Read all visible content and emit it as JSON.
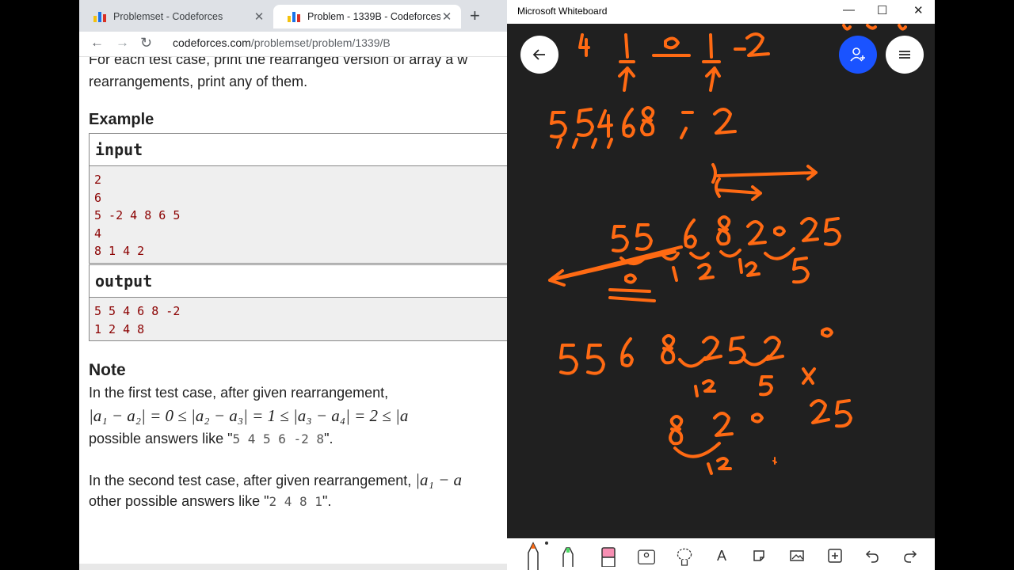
{
  "browser": {
    "tabs": [
      {
        "title": "Problemset - Codeforces",
        "close": "✕"
      },
      {
        "title": "Problem - 1339B - Codeforces",
        "close": "✕"
      }
    ],
    "new_tab": "+",
    "nav": {
      "back": "←",
      "forward": "→",
      "reload": "↻"
    },
    "url_host": "codeforces.com",
    "url_path": "/problemset/problem/1339/B"
  },
  "problem": {
    "partial_top": "For each test case, print the rearranged version of array a w",
    "rearr_line": "rearrangements, print any of them.",
    "example_heading": "Example",
    "input_label": "input",
    "input_lines": [
      "2",
      "6",
      "5 -2 4 8 6 5",
      "4",
      "8 1 4 2"
    ],
    "output_label": "output",
    "output_lines": [
      "5 5 4 6 8 -2",
      "1 2 4 8"
    ],
    "note_heading": "Note",
    "note1_text": "In the first test case, after given rearrangement,",
    "note1_math": "|a₁ − a₂| = 0 ≤ |a₂ − a₃| = 1 ≤ |a₃ − a₄| = 2 ≤ |a",
    "note1_tail_pre": "possible answers like \"",
    "note1_tail_code": "5 4 5 6 -2 8",
    "note1_tail_post": "\".",
    "note2_text": "In the second test case, after given rearrangement,",
    "note2_math": "|a₁ − a",
    "note2_tail_pre": "other possible answers like \"",
    "note2_tail_code": "2 4 8 1",
    "note2_tail_post": "\"."
  },
  "whiteboard": {
    "title": "Microsoft Whiteboard",
    "controls": {
      "minimize": "—",
      "maximize": "☐",
      "close": "✕"
    },
    "ink_color": "#ff6a13",
    "ink_text": {
      "top_row": "4 1 0 1 2",
      "seq": "5,5,4,6,8 ,-2",
      "mid_row": "5 5 6 8 2 0 25",
      "mid_diffs": "0 1 2 12 5",
      "low_row": "5 5 6 8 2 5 2 0",
      "low_diffs": "12 5 4",
      "bottom_row": "8 2 0 2 5",
      "bottom_diff": "12"
    },
    "tools": [
      "pen",
      "highlighter",
      "eraser",
      "lasso",
      "ruler",
      "text",
      "note",
      "image",
      "add",
      "undo",
      "redo"
    ],
    "text_tool": "A"
  },
  "colors": {
    "wb_bg": "#202020",
    "accent_blue": "#1a53ff",
    "code_red": "#8b0000",
    "tab_bg": "#dee1e6"
  }
}
